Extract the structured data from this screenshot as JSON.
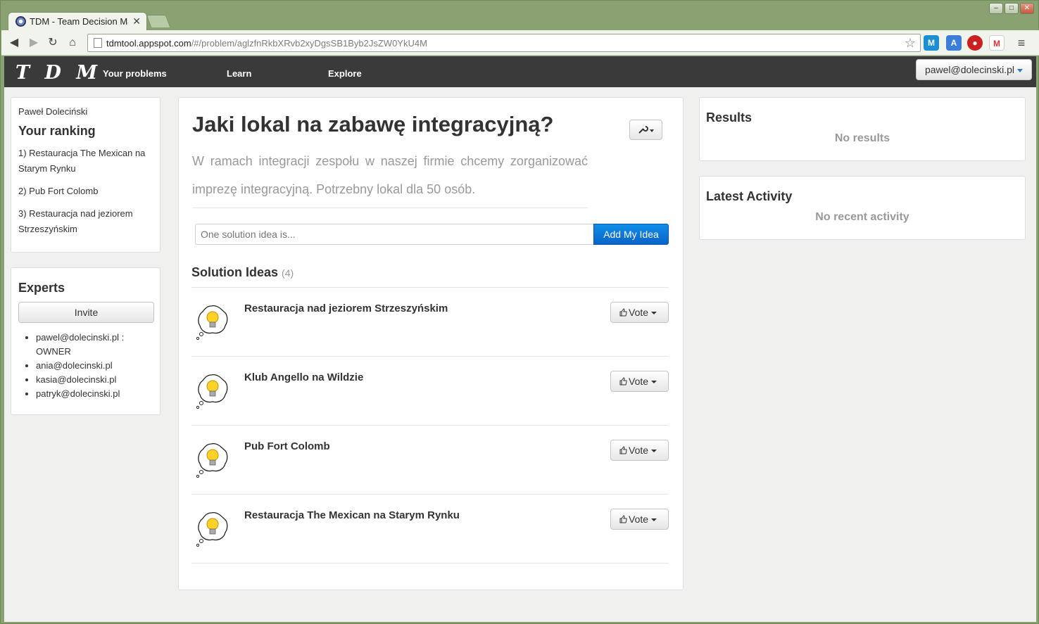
{
  "browser": {
    "tab_title": "TDM - Team Decision Ma",
    "url_host": "tdmtool.appspot.com",
    "url_path": "/#/problem/aglzfnRkbXRvb2xyDgsSB1Byb2JsZW0YkU4M"
  },
  "app": {
    "brand": "T D M",
    "nav": [
      "Your problems",
      "Learn",
      "Explore"
    ],
    "user_menu": "pawel@dolecinski.pl"
  },
  "sidebar": {
    "user_name": "Paweł Doleciński",
    "ranking_title": "Your ranking",
    "ranking": [
      "1) Restauracja The Mexican na Starym Rynku",
      "2) Pub Fort Colomb",
      "3) Restauracja nad jeziorem Strzeszyńskim"
    ],
    "experts_title": "Experts",
    "invite_label": "Invite",
    "experts": [
      "pawel@dolecinski.pl : OWNER",
      "ania@dolecinski.pl",
      "kasia@dolecinski.pl",
      "patryk@dolecinski.pl"
    ]
  },
  "problem": {
    "title": "Jaki lokal na zabawę integracyjną?",
    "description": "W ramach integracji zespołu w naszej firmie chcemy zorganizować imprezę integracyjną. Potrzebny lokal dla 50 osób.",
    "idea_placeholder": "One solution idea is...",
    "add_idea_label": "Add My Idea",
    "ideas_title": "Solution Ideas",
    "ideas_count": "(4)",
    "vote_label": "Vote",
    "ideas": [
      "Restauracja nad jeziorem Strzeszyńskim",
      "Klub Angello na Wildzie",
      "Pub Fort Colomb",
      "Restauracja The Mexican na Starym Rynku"
    ]
  },
  "results": {
    "title": "Results",
    "empty": "No results"
  },
  "activity": {
    "title": "Latest Activity",
    "empty": "No recent activity"
  },
  "colors": {
    "appbar": "#3a3a3a",
    "primary_button": "#0a63c9",
    "window_frame": "#8aa272"
  }
}
